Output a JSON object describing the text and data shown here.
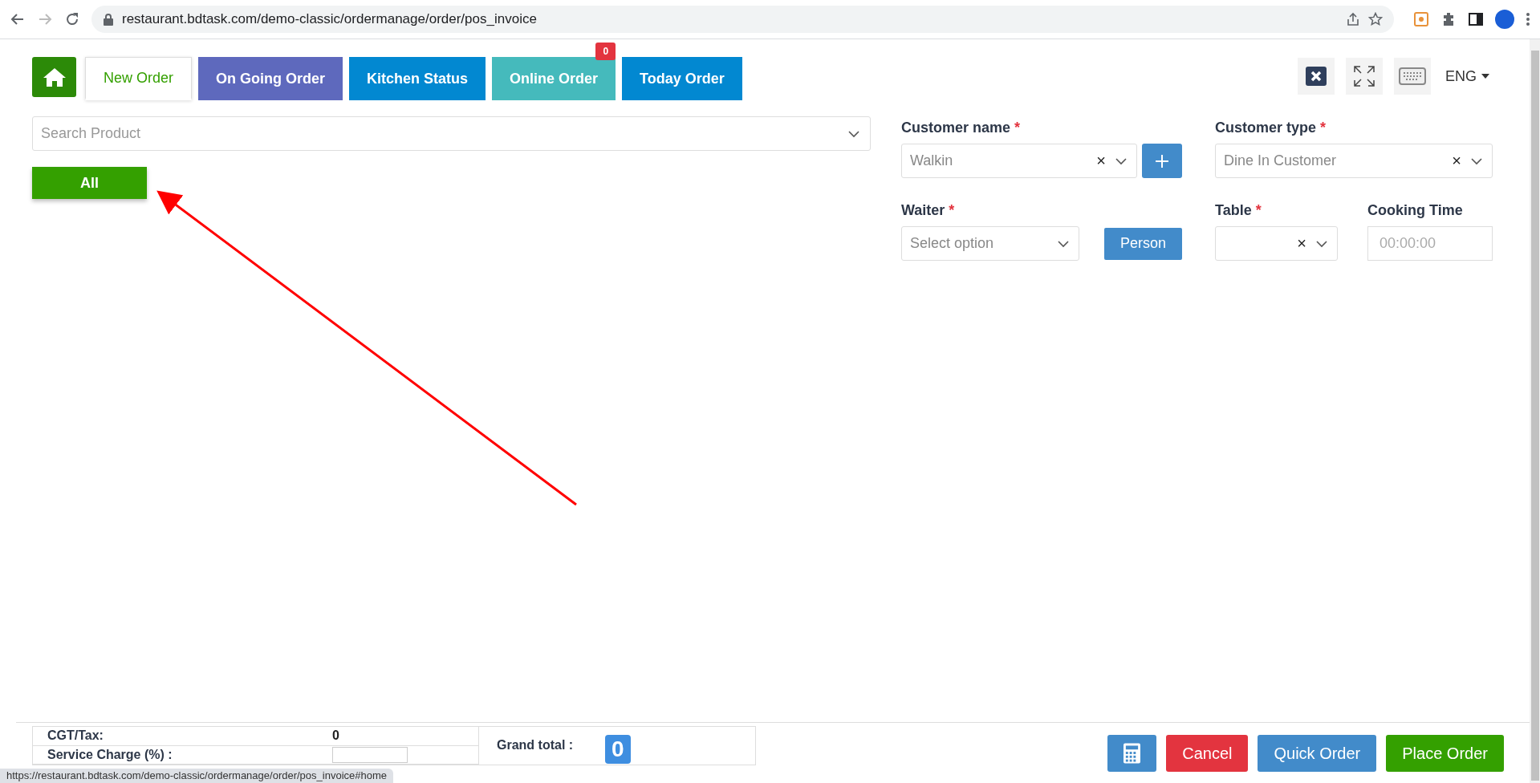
{
  "browser": {
    "url": "restaurant.bdtask.com/demo-classic/ordermanage/order/pos_invoice"
  },
  "tabs": [
    {
      "label": "New Order",
      "selected": true,
      "color": "#ffffff"
    },
    {
      "label": "On Going Order",
      "selected": false,
      "color": "#5e69bd"
    },
    {
      "label": "Kitchen Status",
      "selected": false,
      "color": "#0288d1"
    },
    {
      "label": "Online Order",
      "selected": false,
      "color": "#45babc",
      "badge": "0"
    },
    {
      "label": "Today Order",
      "selected": false,
      "color": "#0288d1"
    }
  ],
  "language": "ENG",
  "search": {
    "placeholder": "Search Product"
  },
  "categories": [
    {
      "label": "All",
      "selected": true
    }
  ],
  "form": {
    "customer_name": {
      "label": "Customer name",
      "mark": "*",
      "value": "Walkin",
      "clear": "×"
    },
    "customer_type": {
      "label": "Customer type",
      "mark": "*",
      "value": "Dine In Customer",
      "clear": "×"
    },
    "waiter": {
      "label": "Waiter",
      "mark": "*",
      "placeholder": "Select option"
    },
    "person_button": "Person",
    "table": {
      "label": "Table",
      "mark": "*",
      "clear": "×"
    },
    "cooking_time": {
      "label": "Cooking Time",
      "placeholder": "00:00:00"
    }
  },
  "summary": [
    {
      "kind": "text",
      "label": "CGT/Tax:",
      "value": "0"
    },
    {
      "kind": "input",
      "label": "Service Charge (%) :"
    }
  ],
  "grand_total": {
    "label": "Grand total :",
    "value": "0"
  },
  "actions": [
    {
      "kind": "calculator",
      "color": "#428bca"
    },
    {
      "kind": "text",
      "label": "Cancel",
      "color": "#e3343f"
    },
    {
      "kind": "text",
      "label": "Quick Order",
      "color": "#428bca"
    },
    {
      "kind": "text",
      "label": "Place Order",
      "color": "#34a000"
    }
  ],
  "status_url": "https://restaurant.bdtask.com/demo-classic/ordermanage/order/pos_invoice#home"
}
